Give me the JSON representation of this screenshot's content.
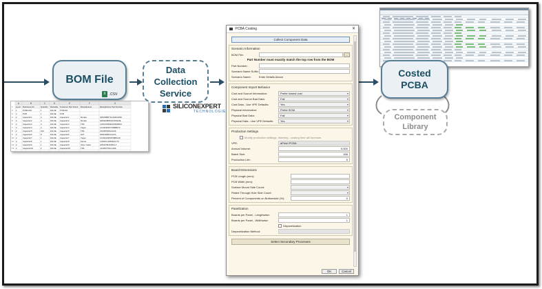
{
  "colors": {
    "node_border": "#557d94",
    "node_text": "#1c4e63",
    "arrow": "#2d4e62",
    "library_text": "#8c8c8c"
  },
  "nodes": {
    "bom_file": "BOM File",
    "csv_badge": ".csv",
    "data_collection": [
      "Data",
      "Collection",
      "Service"
    ],
    "costed": [
      "Costed",
      "PCBA"
    ],
    "library": [
      "Component",
      "Library"
    ]
  },
  "logo": {
    "brand": "SILICONEXPERT",
    "sub": "TECHNOLOGIES",
    "icon": "siliconexpert-logo-icon"
  },
  "bom_sheet": {
    "columns": [
      "A",
      "B",
      "C",
      "D",
      "E",
      "F",
      "G"
    ],
    "headers": [
      "Level",
      "Reference ID",
      "Quantity",
      "Manually Override",
      "Customer Part Number",
      "Manufacturer",
      "Manufacturer Part Number"
    ],
    "rows": [
      [
        "1",
        "PCBA-001",
        "1",
        "FALSE",
        "PCB-001",
        "",
        ""
      ],
      [
        "2",
        "PCB",
        "1",
        "FALSE",
        "PCB",
        "",
        ""
      ],
      [
        "2",
        "Capacitor1",
        "4",
        "FALSE",
        "Capacitor1",
        "Murata",
        "GRM188R71H104KA93D"
      ],
      [
        "2",
        "Capacitor2",
        "4",
        "FALSE",
        "Capacitor2",
        "Murata",
        "GRM21BR60J106KE19L"
      ],
      [
        "2",
        "Capacitor3",
        "4",
        "FALSE",
        "Capacitor3",
        "TDK",
        "C2012X5R1E106K085AC"
      ],
      [
        "2",
        "Capacitor4",
        "4",
        "FALSE",
        "Capacitor4",
        "Yageo",
        "CC0402KRX7R9BB472"
      ],
      [
        "2",
        "Capacitor5",
        "100",
        "FALSE",
        "Capacitor5",
        "TDK",
        "C1005X5R1A104K"
      ],
      [
        "2",
        "Capacitor6",
        "8",
        "FALSE",
        "Capacitor6",
        "AVX",
        "04023A8R2CAT2A"
      ],
      [
        "2",
        "Capacitor7",
        "1",
        "FALSE",
        "Capacitor7",
        "Yageo",
        "CC0402JRNPO9BN100"
      ],
      [
        "2",
        "Capacitor8",
        "1",
        "FALSE",
        "Capacitor8",
        "Kemet",
        "C0402C104K4RACTU"
      ],
      [
        "2",
        "Capacitor9",
        "1",
        "FALSE",
        "Capacitor9",
        "Taiyo Yuden",
        "LMK107BJ105KA-T"
      ],
      [
        "2",
        "Capacitor10",
        "2",
        "FALSE",
        "Capacitor10",
        "TDK",
        "C1005X7R1C104K"
      ],
      [
        "2",
        "Capacitor11",
        "1",
        "FALSE",
        "Capacitor11",
        "Taiyo Yuden",
        "EMK316BJ226ML-T"
      ]
    ]
  },
  "dialog": {
    "title": "PCBA Costing",
    "icon": "pcba-app-icon",
    "close_glyph": "✕",
    "collect_button": "Collect Component Data",
    "scenario": {
      "title": "Scenario Information",
      "bom_file_label": "BOM File:",
      "bom_file_value": "",
      "browse_glyph": "…",
      "warning": "Part Number must exactly match the top row from the BOM",
      "part_number_label": "Part Number:",
      "part_number_value": "",
      "scenario_suffix_label": "Scenario Name Suffix:",
      "scenario_suffix_value": "",
      "scenario_name_label": "Scenario Name:",
      "scenario_name_value": "Enter Details Above"
    },
    "import": {
      "title": "Component Import Behavior",
      "rows": [
        {
          "label": "Cost and Source Information:",
          "value": "Prefer lowest cost"
        },
        {
          "label": "Cost and Source Bad Data:",
          "value": "Fail"
        },
        {
          "label": "Cost Data - Use VPE Defaults:",
          "value": "Yes"
        },
        {
          "label": "Physical Information:",
          "value": "Prefer BOM"
        },
        {
          "label": "Physical Bad Data:",
          "value": "Fail"
        },
        {
          "label": "Physical Data - Use VPE Defaults:",
          "value": "Yes"
        }
      ]
    },
    "production": {
      "title": "Production Settings",
      "modify_label": "Modify production settings. Warning - costing time will increase.",
      "vpe_label": "VPE:",
      "vpe_value": "aPriori PCBA",
      "annual_volume_label": "Annual Volume:",
      "annual_volume_value": "5,500",
      "batch_size_label": "Batch Size:",
      "batch_size_value": "458",
      "production_life_label": "Production Life:",
      "production_life_value": "5"
    },
    "board": {
      "title": "Board Dimensions",
      "rows": [
        {
          "label": "PCB Length (mm):",
          "value": ""
        },
        {
          "label": "PCB Width (mm):",
          "value": ""
        },
        {
          "label": "Surface Mount Side Count:",
          "value": ""
        },
        {
          "label": "Plated Through Hole Side Count:",
          "value": ""
        },
        {
          "label": "Percent of Components on Bottomside (%):",
          "value": "0"
        }
      ]
    },
    "panel": {
      "title": "Panelization",
      "length_label": "Boards per Panel - Lengthwise:",
      "length_value": "1",
      "width_label": "Boards per Panel - Widthwise:",
      "width_value": "1",
      "depanel_label": "Depanelization",
      "method_label": "Depanelization Method:",
      "method_value": ""
    },
    "secondary_button": "Select Secondary Processes",
    "ok_button": "OK",
    "cancel_button": "Cancel"
  }
}
